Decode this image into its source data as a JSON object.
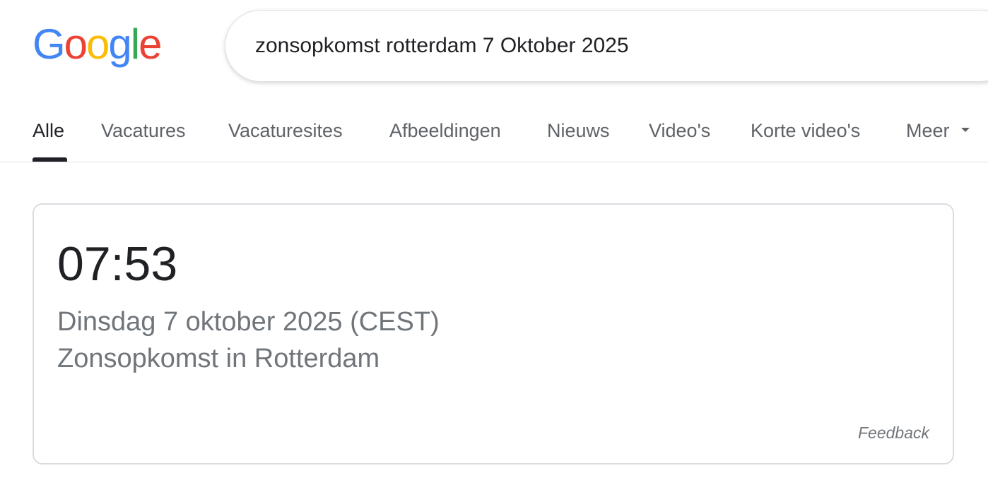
{
  "logo": {
    "letters": [
      "G",
      "o",
      "o",
      "g",
      "l",
      "e"
    ],
    "colors": [
      "#4285F4",
      "#EA4335",
      "#FBBC05",
      "#4285F4",
      "#34A853",
      "#EA4335"
    ]
  },
  "search": {
    "query": "zonsopkomst rotterdam 7 Oktober 2025"
  },
  "tabs": [
    {
      "label": "Alle",
      "active": true
    },
    {
      "label": "Vacatures",
      "active": false
    },
    {
      "label": "Vacaturesites",
      "active": false
    },
    {
      "label": "Afbeeldingen",
      "active": false
    },
    {
      "label": "Nieuws",
      "active": false
    },
    {
      "label": "Video's",
      "active": false
    },
    {
      "label": "Korte video's",
      "active": false
    },
    {
      "label": "Meer",
      "active": false
    }
  ],
  "result": {
    "time": "07:53",
    "date": "Dinsdag 7 oktober 2025 (CEST)",
    "label": "Zonsopkomst in Rotterdam",
    "feedback": "Feedback"
  }
}
